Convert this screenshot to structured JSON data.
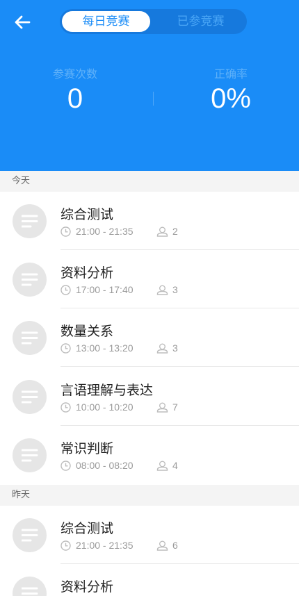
{
  "header": {
    "tabs": [
      {
        "label": "每日竞赛",
        "active": true
      },
      {
        "label": "已参竞赛",
        "active": false
      }
    ],
    "stats": [
      {
        "label": "参赛次数",
        "value": "0"
      },
      {
        "label": "正确率",
        "value": "0%"
      }
    ]
  },
  "sections": [
    {
      "label": "今天",
      "items": [
        {
          "title": "综合测试",
          "time": "21:00 - 21:35",
          "count": "2"
        },
        {
          "title": "资料分析",
          "time": "17:00 - 17:40",
          "count": "3"
        },
        {
          "title": "数量关系",
          "time": "13:00 - 13:20",
          "count": "3"
        },
        {
          "title": "言语理解与表达",
          "time": "10:00 - 10:20",
          "count": "7"
        },
        {
          "title": "常识判断",
          "time": "08:00 - 08:20",
          "count": "4"
        }
      ]
    },
    {
      "label": "昨天",
      "items": [
        {
          "title": "综合测试",
          "time": "21:00 - 21:35",
          "count": "6"
        },
        {
          "title": "资料分析",
          "time": "",
          "count": ""
        }
      ]
    }
  ],
  "colors": {
    "header_bg": "#1a8cf7",
    "tab_track": "#1679dd",
    "section_bg": "#f4f4f4"
  }
}
